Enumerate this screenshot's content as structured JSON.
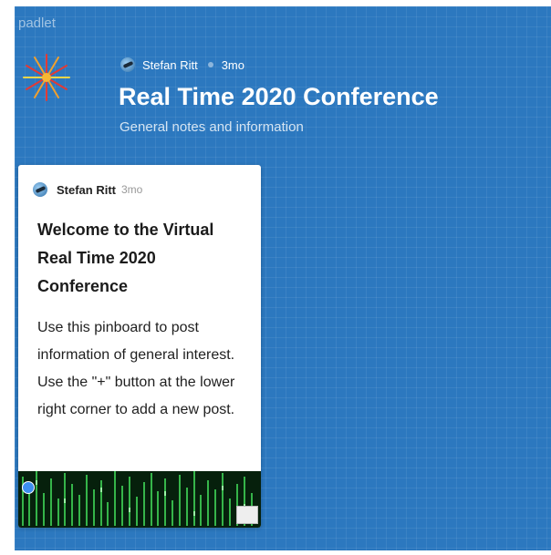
{
  "app": {
    "brand": "padlet"
  },
  "header": {
    "author": "Stefan Ritt",
    "time": "3mo",
    "title": "Real Time 2020 Conference",
    "subtitle": "General notes and information",
    "icon": "firework-icon"
  },
  "post": {
    "author": "Stefan Ritt",
    "time": "3mo",
    "title": "Welcome to the Virtual Real Time 2020 Conference",
    "body": "Use this pinboard to post information of general interest. Use the \"+\" button at the lower right corner to add a new post.",
    "attachment": "matrix-style green code image"
  },
  "colors": {
    "board_background": "#2c78bf",
    "card_background": "#ffffff"
  }
}
